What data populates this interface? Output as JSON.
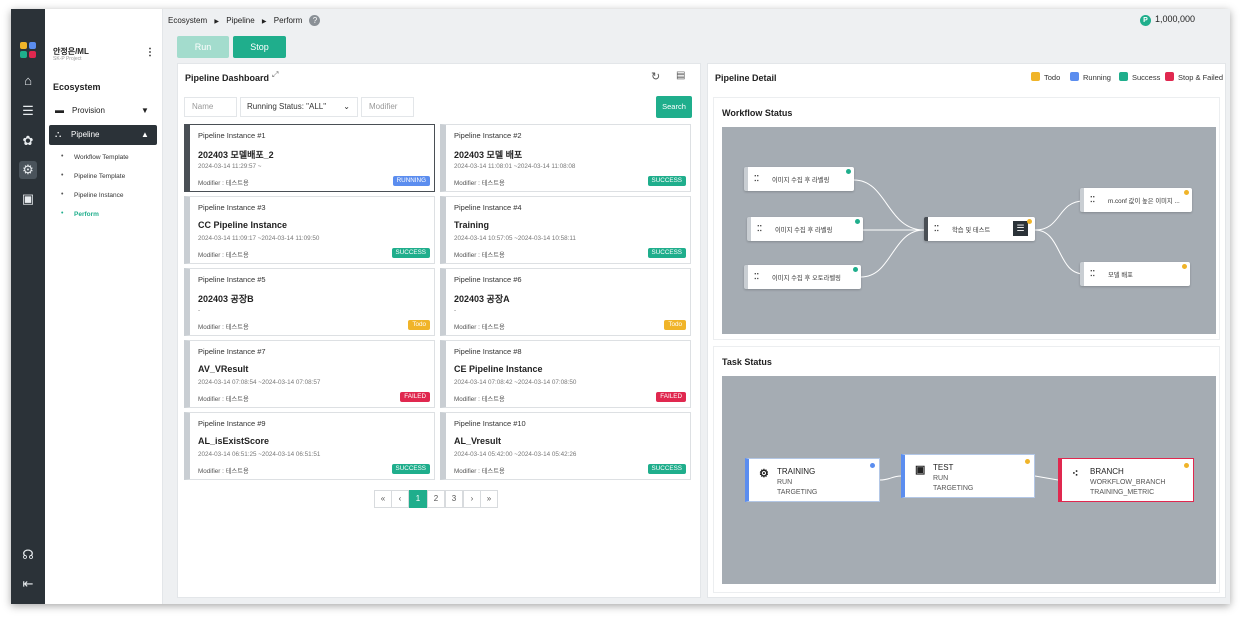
{
  "breadcrumb": [
    "Ecosystem",
    "Pipeline",
    "Perform"
  ],
  "points": "1,000,000",
  "points_badge": "P",
  "user": {
    "name": "안정은/ML",
    "project": "SK-P Project"
  },
  "sidebar": {
    "section": "Ecosystem",
    "items": [
      {
        "label": "Provision",
        "icon": "server-icon"
      },
      {
        "label": "Pipeline",
        "icon": "hierarchy-icon"
      }
    ],
    "sub_items": [
      "Workflow Template",
      "Pipeline Template",
      "Pipeline Instance",
      "Perform"
    ]
  },
  "rail_icons": [
    "home-icon",
    "database-icon",
    "brain-icon",
    "gear-icon",
    "monitor-icon",
    "headset-icon",
    "logout-icon"
  ],
  "buttons": {
    "run": "Run",
    "stop": "Stop",
    "search": "Search"
  },
  "dashboard": {
    "title": "Pipeline Dashboard",
    "filters": {
      "name_placeholder": "Name",
      "status": "Running Status: \"ALL\"",
      "modifier_placeholder": "Modifier"
    },
    "cards": [
      {
        "instance": "Pipeline Instance #1",
        "title": "202403 모델배포_2",
        "time": "2024-03-14 11:29:57 ~",
        "modifier": "Modifier : 테스트용",
        "status": "RUNNING"
      },
      {
        "instance": "Pipeline Instance #2",
        "title": "202403 모델 배포",
        "time": "2024-03-14 11:08:01 ~2024-03-14 11:08:08",
        "modifier": "Modifier : 테스트용",
        "status": "SUCCESS"
      },
      {
        "instance": "Pipeline Instance #3",
        "title": "CC Pipeline Instance",
        "time": "2024-03-14 11:09:17 ~2024-03-14 11:09:50",
        "modifier": "Modifier : 테스트용",
        "status": "SUCCESS"
      },
      {
        "instance": "Pipeline Instance #4",
        "title": "Training",
        "time": "2024-03-14 10:57:05 ~2024-03-14 10:58:11",
        "modifier": "Modifier : 테스트용",
        "status": "SUCCESS"
      },
      {
        "instance": "Pipeline Instance #5",
        "title": "202403 공장B",
        "time": "-",
        "modifier": "Modifier : 테스트용",
        "status": "Todo"
      },
      {
        "instance": "Pipeline Instance #6",
        "title": "202403 공장A",
        "time": "-",
        "modifier": "Modifier : 테스트용",
        "status": "Todo"
      },
      {
        "instance": "Pipeline Instance #7",
        "title": "AV_VResult",
        "time": "2024-03-14 07:08:54 ~2024-03-14 07:08:57",
        "modifier": "Modifier : 테스트용",
        "status": "FAILED"
      },
      {
        "instance": "Pipeline Instance #8",
        "title": "CE Pipeline Instance",
        "time": "2024-03-14 07:08:42 ~2024-03-14 07:08:50",
        "modifier": "Modifier : 테스트용",
        "status": "FAILED"
      },
      {
        "instance": "Pipeline Instance #9",
        "title": "AL_isExistScore",
        "time": "2024-03-14 06:51:25 ~2024-03-14 06:51:51",
        "modifier": "Modifier : 테스트용",
        "status": "SUCCESS"
      },
      {
        "instance": "Pipeline Instance #10",
        "title": "AL_Vresult",
        "time": "2024-03-14 05:42:00 ~2024-03-14 05:42:26",
        "modifier": "Modifier : 테스트용",
        "status": "SUCCESS"
      }
    ],
    "pagination": {
      "first": "«",
      "prev": "‹",
      "pages": [
        "1",
        "2",
        "3"
      ],
      "current": "1",
      "next": "›",
      "last": "»"
    }
  },
  "detail": {
    "title": "Pipeline Detail",
    "legend": [
      {
        "label": "Todo",
        "color": "#f0b429"
      },
      {
        "label": "Running",
        "color": "#5b8def"
      },
      {
        "label": "Success",
        "color": "#1fae8c"
      },
      {
        "label": "Stop & Failed",
        "color": "#e0284f"
      }
    ],
    "workflow_title": "Workflow Status",
    "workflow_nodes": [
      {
        "label": "이미지 수집 후 라벨링",
        "status": "Success"
      },
      {
        "label": "이미지 수집 후 라벨링",
        "status": "Success"
      },
      {
        "label": "이미지 수집 후 오토라벨링",
        "status": "Success"
      },
      {
        "label": "학습 및 테스트",
        "status": "Todo"
      },
      {
        "label": "m.conf 값이 높은 이미지 ...",
        "status": "Todo"
      },
      {
        "label": "모델 배포",
        "status": "Todo"
      }
    ],
    "task_title": "Task Status",
    "tasks": [
      {
        "name": "TRAINING",
        "l1": "RUN",
        "l2": "TARGETING",
        "status": "Running"
      },
      {
        "name": "TEST",
        "l1": "RUN",
        "l2": "TARGETING",
        "status": "Todo"
      },
      {
        "name": "BRANCH",
        "l1": "WORKFLOW_BRANCH",
        "l2": "TRAINING_METRIC",
        "status": "Todo"
      }
    ]
  },
  "colors": {
    "run_disabled": "#a3dccd",
    "stop": "#1fae8c",
    "running": "#5b8def",
    "success": "#1fae8c",
    "todo": "#f0b429",
    "failed": "#e0284f",
    "canvas": "#a5acb3"
  }
}
